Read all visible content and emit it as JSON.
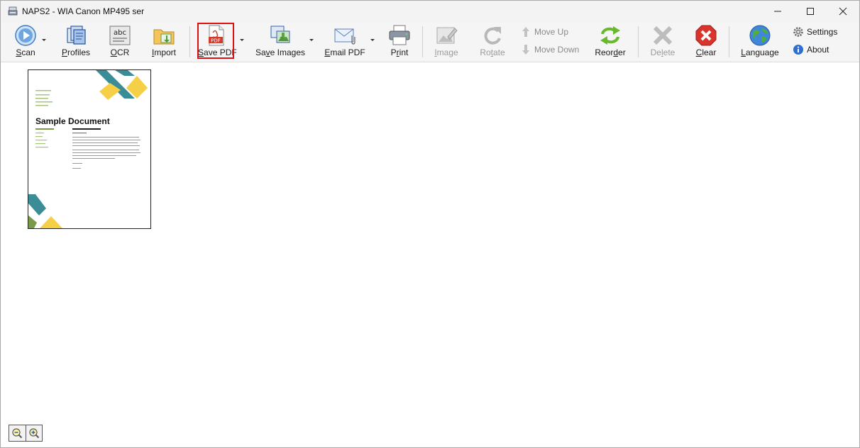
{
  "window": {
    "title": "NAPS2 - WIA Canon MP495 ser"
  },
  "toolbar": {
    "scan": {
      "pre": "",
      "u": "S",
      "post": "can"
    },
    "profiles": {
      "pre": "",
      "u": "P",
      "post": "rofiles"
    },
    "ocr": {
      "pre": "",
      "u": "O",
      "post": "CR"
    },
    "import": {
      "pre": "",
      "u": "I",
      "post": "mport"
    },
    "save_pdf": {
      "pre": "",
      "u": "S",
      "post": "ave PDF"
    },
    "save_images": {
      "pre": "Sa",
      "u": "v",
      "post": "e Images"
    },
    "email_pdf": {
      "pre": "",
      "u": "E",
      "post": "mail PDF"
    },
    "print": {
      "pre": "P",
      "u": "r",
      "post": "int"
    },
    "image": {
      "pre": "",
      "u": "I",
      "post": "mage"
    },
    "rotate": {
      "pre": "Ro",
      "u": "t",
      "post": "ate"
    },
    "move_up": "Move Up",
    "move_down": "Move Down",
    "reorder": {
      "pre": "Reor",
      "u": "d",
      "post": "er"
    },
    "delete": {
      "pre": "De",
      "u": "l",
      "post": "ete"
    },
    "clear": {
      "pre": "",
      "u": "C",
      "post": "lear"
    },
    "language": {
      "pre": "",
      "u": "L",
      "post": "anguage"
    },
    "settings": "Settings",
    "about": "About"
  },
  "thumbnail": {
    "title": "Sample Document",
    "accent_colors": {
      "teal": "#3a8c96",
      "yellow": "#f5cf45",
      "green": "#7a9a4a"
    }
  },
  "colors": {
    "highlight": "#d11111",
    "clear_red": "#d9332b",
    "reorder_green": "#6ab82d"
  }
}
